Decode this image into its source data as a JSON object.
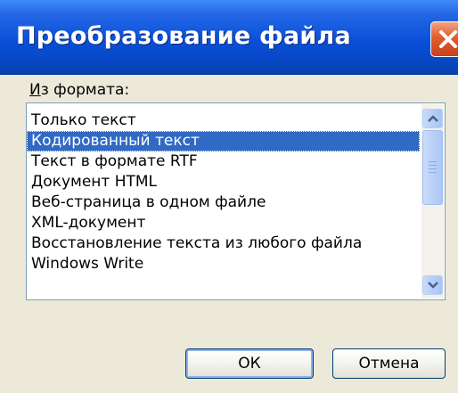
{
  "window": {
    "title": "Преобразование файла",
    "close_icon": "close-icon"
  },
  "format": {
    "label_accel": "И",
    "label_rest": "з формата:"
  },
  "list": {
    "items": [
      "Только текст",
      "Кодированный текст",
      "Текст в формате RTF",
      "Документ HTML",
      "Веб-страница в одном файле",
      "XML-документ",
      "Восстановление текста из любого файла",
      "Windows Write"
    ],
    "selected_index": 1
  },
  "buttons": {
    "ok": "ОК",
    "cancel": "Отмена"
  },
  "colors": {
    "title_bar": "#0a4fd9",
    "selection": "#316ac5",
    "close_button": "#e35c2e",
    "dialog_background": "#ece9d8"
  }
}
